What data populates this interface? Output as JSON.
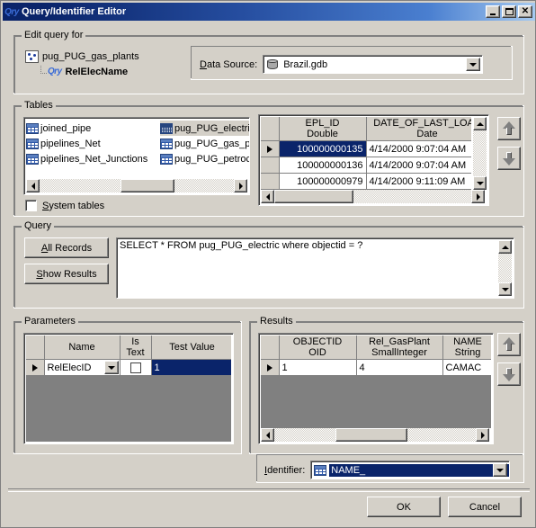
{
  "window": {
    "title": "Query/Identifier Editor",
    "title_icon": "Qry",
    "buttons": {
      "minimize": "minimize-icon",
      "maximize": "maximize-icon",
      "close": "✕"
    }
  },
  "edit_query_for": {
    "group_title": "Edit query for",
    "tree": [
      {
        "label": "pug_PUG_gas_plants",
        "icon": "point-feature-icon",
        "bold": false
      },
      {
        "label": "RelElecName",
        "icon": "query-icon",
        "icon_text": "Qry",
        "bold": true
      }
    ],
    "data_source": {
      "label": "Data Source:",
      "accel": "D",
      "value": "Brazil.gdb",
      "icon": "database-icon"
    }
  },
  "tables": {
    "group_title": "Tables",
    "left_column": [
      {
        "label": "joined_pipe",
        "selected": false
      },
      {
        "label": "pipelines_Net",
        "selected": false
      },
      {
        "label": "pipelines_Net_Junctions",
        "selected": false
      }
    ],
    "right_column": [
      {
        "label": "pug_PUG_electric",
        "selected": true
      },
      {
        "label": "pug_PUG_gas_pl",
        "selected": false
      },
      {
        "label": "pug_PUG_petroc",
        "selected": false
      }
    ],
    "system_tables": {
      "label": "System tables",
      "accel": "S",
      "checked": false
    },
    "preview_grid": {
      "columns": [
        {
          "name": "EPL_ID",
          "type": "Double"
        },
        {
          "name": "DATE_OF_LAST_LOAD",
          "type": "Date"
        }
      ],
      "rows": [
        {
          "marker": true,
          "cells": [
            "100000000135",
            "4/14/2000 9:07:04 AM"
          ],
          "selected_cell": 0
        },
        {
          "marker": false,
          "cells": [
            "100000000136",
            "4/14/2000 9:07:04 AM"
          ],
          "selected_cell": -1
        },
        {
          "marker": false,
          "cells": [
            "100000000979",
            "4/14/2000 9:11:09 AM"
          ],
          "selected_cell": -1
        }
      ]
    },
    "nav": {
      "up": "move-up-icon",
      "down": "move-down-icon"
    }
  },
  "query": {
    "group_title": "Query",
    "all_records_label": "All Records",
    "all_records_accel": "A",
    "show_results_label": "Show Results",
    "show_results_accel": "S",
    "sql": "SELECT * FROM pug_PUG_electric where objectid = ?"
  },
  "parameters": {
    "group_title": "Parameters",
    "columns": [
      "",
      "Name",
      "Is\nText",
      "Test Value"
    ],
    "column_name": "Name",
    "column_istext_line1": "Is",
    "column_istext_line2": "Text",
    "column_testvalue": "Test Value",
    "rows": [
      {
        "marker": true,
        "name": "RelElecID",
        "is_text": false,
        "test_value": "1"
      }
    ]
  },
  "results": {
    "group_title": "Results",
    "columns": [
      {
        "name": "OBJECTID",
        "type": "OID"
      },
      {
        "name": "Rel_GasPlant",
        "type": "SmallInteger"
      },
      {
        "name": "NAME",
        "type": "String"
      }
    ],
    "rows": [
      {
        "marker": true,
        "cells": [
          "1",
          "4",
          "CAMAC"
        ]
      }
    ],
    "nav": {
      "up": "move-up-icon",
      "down": "move-down-icon"
    }
  },
  "identifier": {
    "label": "Identifier:",
    "accel": "I",
    "value": "NAME_",
    "icon": "table-icon"
  },
  "footer": {
    "ok_label": "OK",
    "cancel_label": "Cancel"
  },
  "colors": {
    "dialog_face": "#d4d0c8",
    "title_start": "#0a246a",
    "title_end": "#a6caf0",
    "selection": "#0a246a",
    "selection_text": "#ffffff"
  }
}
